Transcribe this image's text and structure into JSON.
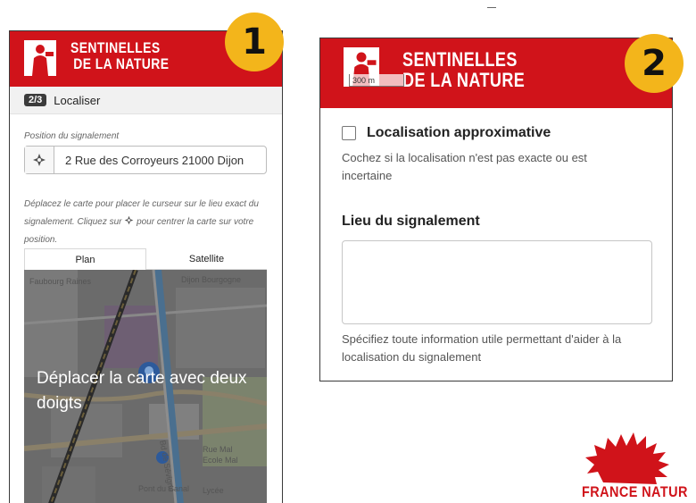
{
  "panel1": {
    "badge_number": "1",
    "logo_line1": "SENTINELLES",
    "logo_line2": "DE LA NATURE",
    "step_badge": "2/3",
    "step_label": "Localiser",
    "field_label": "Position du signalement",
    "address_value": "2 Rue des Corroyeurs 21000 Dijon",
    "help_text_before_icon": "Déplacez le carte pour placer le curseur sur le lieu exact du signalement. Cliquez sur",
    "help_text_after_icon": "pour centrer la carte sur votre position.",
    "tabs": [
      {
        "label": "Plan",
        "active": true
      },
      {
        "label": "Satellite",
        "active": false
      }
    ],
    "map_overlay_text": "Déplacer la carte avec deux doigts",
    "map_labels": [
      "Faubourg Raines",
      "Dijon Bourgogne",
      "Rue Mal",
      "Ecole Mal",
      "Pont du Canal",
      "Lycée",
      "Bd de Sévigné"
    ]
  },
  "panel2": {
    "badge_number": "2",
    "logo_line1": "SENTINELLES",
    "logo_line2": "DE LA NATURE",
    "scale_label": "300 m",
    "checkbox_label": "Localisation approximative",
    "checkbox_checked": false,
    "checkbox_help": "Cochez si la localisation n'est pas exacte ou est incertaine",
    "lieu_title": "Lieu du signalement",
    "textarea_value": "",
    "lieu_help": "Spécifiez toute information utile permettant d'aider à la localisation du signalement"
  },
  "france_nature": {
    "text": "FRANCE NATUR"
  },
  "colors": {
    "brand_red": "#d0131a",
    "badge_yellow": "#f3b51b",
    "map_dark": "#3f3f3f"
  }
}
